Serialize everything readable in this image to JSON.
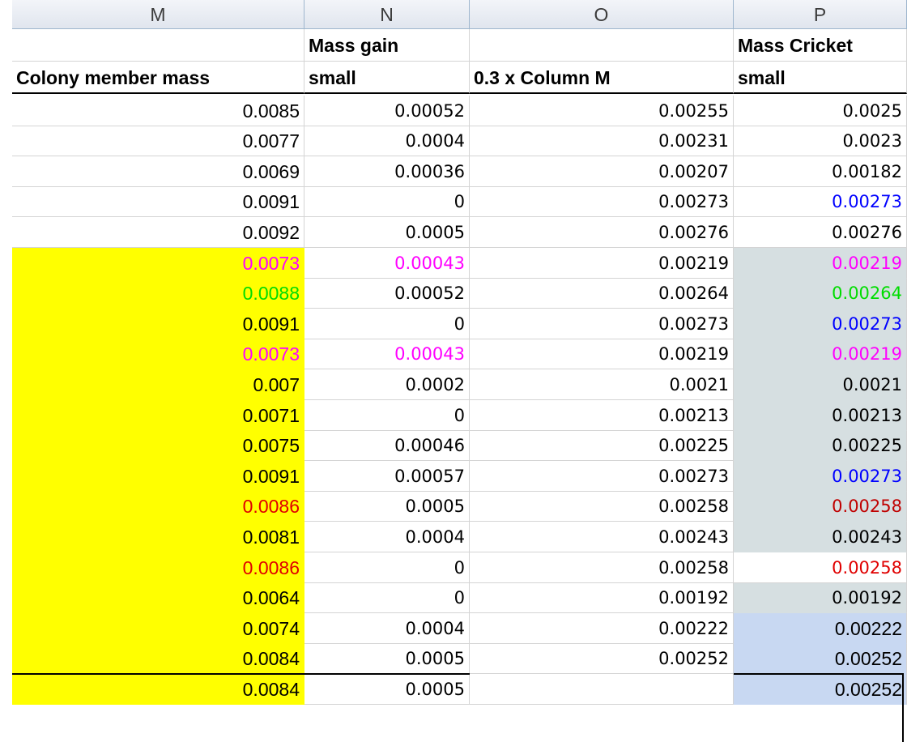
{
  "column_headers": [
    "M",
    "N",
    "O",
    "P"
  ],
  "header_row1": [
    "",
    "Mass gain",
    "",
    "Mass Cricket"
  ],
  "header_row2": [
    "Colony member mass",
    "small",
    "0.3 x Column M",
    "small"
  ],
  "colors": {
    "yellow": "#ffff00",
    "gray": "#d6dfe1",
    "blue_fill": "#c8d8f2",
    "magenta": "#ff00ff",
    "green": "#00dd00",
    "blue": "#0000ff",
    "red": "#e00000",
    "dark_red": "#c00000",
    "black": "#000000"
  },
  "rows": [
    {
      "cells": [
        "0.0085",
        "0.00052",
        "0.00255",
        "0.0025"
      ],
      "colors": [
        "black",
        "black",
        "black",
        "black"
      ],
      "fill_m": "",
      "fill_p": ""
    },
    {
      "cells": [
        "0.0077",
        "0.0004",
        "0.00231",
        "0.0023"
      ],
      "colors": [
        "black",
        "black",
        "black",
        "black"
      ],
      "fill_m": "",
      "fill_p": ""
    },
    {
      "cells": [
        "0.0069",
        "0.00036",
        "0.00207",
        "0.00182"
      ],
      "colors": [
        "black",
        "black",
        "black",
        "black"
      ],
      "fill_m": "",
      "fill_p": ""
    },
    {
      "cells": [
        "0.0091",
        "0",
        "0.00273",
        "0.00273"
      ],
      "colors": [
        "black",
        "black",
        "black",
        "blue"
      ],
      "fill_m": "",
      "fill_p": ""
    },
    {
      "cells": [
        "0.0092",
        "0.0005",
        "0.00276",
        "0.00276"
      ],
      "colors": [
        "black",
        "black",
        "black",
        "black"
      ],
      "fill_m": "",
      "fill_p": ""
    },
    {
      "cells": [
        "0.0073",
        "0.00043",
        "0.00219",
        "0.00219"
      ],
      "colors": [
        "magenta",
        "magenta",
        "black",
        "magenta"
      ],
      "fill_m": "yellow",
      "fill_p": "gray"
    },
    {
      "cells": [
        "0.0088",
        "0.00052",
        "0.00264",
        "0.00264"
      ],
      "colors": [
        "green",
        "black",
        "black",
        "green"
      ],
      "fill_m": "yellow",
      "fill_p": "gray"
    },
    {
      "cells": [
        "0.0091",
        "0",
        "0.00273",
        "0.00273"
      ],
      "colors": [
        "black",
        "black",
        "black",
        "blue"
      ],
      "fill_m": "yellow",
      "fill_p": "gray"
    },
    {
      "cells": [
        "0.0073",
        "0.00043",
        "0.00219",
        "0.00219"
      ],
      "colors": [
        "magenta",
        "magenta",
        "black",
        "magenta"
      ],
      "fill_m": "yellow",
      "fill_p": "gray"
    },
    {
      "cells": [
        "0.007",
        "0.0002",
        "0.0021",
        "0.0021"
      ],
      "colors": [
        "black",
        "black",
        "black",
        "black"
      ],
      "fill_m": "yellow",
      "fill_p": "gray"
    },
    {
      "cells": [
        "0.0071",
        "0",
        "0.00213",
        "0.00213"
      ],
      "colors": [
        "black",
        "black",
        "black",
        "black"
      ],
      "fill_m": "yellow",
      "fill_p": "gray"
    },
    {
      "cells": [
        "0.0075",
        "0.00046",
        "0.00225",
        "0.00225"
      ],
      "colors": [
        "black",
        "black",
        "black",
        "black"
      ],
      "fill_m": "yellow",
      "fill_p": "gray"
    },
    {
      "cells": [
        "0.0091",
        "0.00057",
        "0.00273",
        "0.00273"
      ],
      "colors": [
        "black",
        "black",
        "black",
        "blue"
      ],
      "fill_m": "yellow",
      "fill_p": "gray"
    },
    {
      "cells": [
        "0.0086",
        "0.0005",
        "0.00258",
        "0.00258"
      ],
      "colors": [
        "red",
        "black",
        "black",
        "dark_red"
      ],
      "fill_m": "yellow",
      "fill_p": "gray"
    },
    {
      "cells": [
        "0.0081",
        "0.0004",
        "0.00243",
        "0.00243"
      ],
      "colors": [
        "black",
        "black",
        "black",
        "black"
      ],
      "fill_m": "yellow",
      "fill_p": "gray"
    },
    {
      "cells": [
        "0.0086",
        "0",
        "0.00258",
        "0.00258"
      ],
      "colors": [
        "red",
        "black",
        "black",
        "red"
      ],
      "fill_m": "yellow",
      "fill_p": ""
    },
    {
      "cells": [
        "0.0064",
        "0",
        "0.00192",
        "0.00192"
      ],
      "colors": [
        "black",
        "black",
        "black",
        "black"
      ],
      "fill_m": "yellow",
      "fill_p": "gray"
    },
    {
      "cells": [
        "0.0074",
        "0.0004",
        "0.00222",
        "0.00222"
      ],
      "colors": [
        "black",
        "black",
        "black",
        "black"
      ],
      "fill_m": "yellow",
      "fill_p": "blue_fill"
    },
    {
      "cells": [
        "0.0084",
        "0.0005",
        "0.00252",
        "0.00252"
      ],
      "colors": [
        "black",
        "black",
        "black",
        "black"
      ],
      "fill_m": "yellow",
      "fill_p": "blue_fill"
    },
    {
      "cells": [
        "0.0084",
        "0.0005",
        "",
        "0.00252"
      ],
      "colors": [
        "black",
        "black",
        "black",
        "black"
      ],
      "fill_m": "yellow",
      "fill_p": "blue_fill"
    }
  ]
}
